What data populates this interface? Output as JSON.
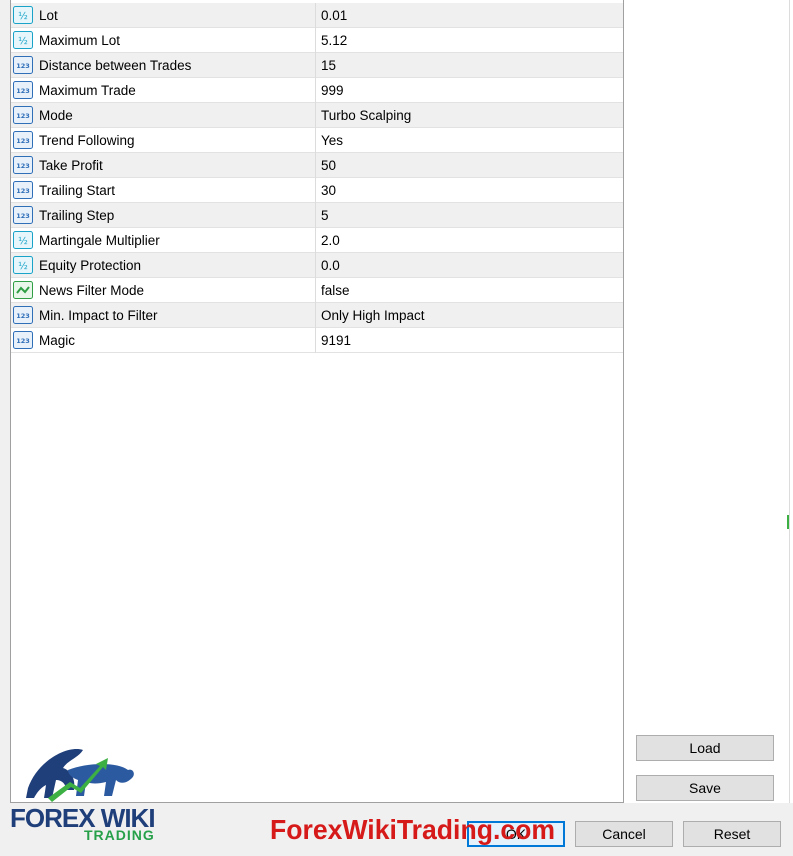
{
  "parameters": [
    {
      "name": "Lot",
      "value": "0.01",
      "icon": "fraction-icon"
    },
    {
      "name": "Maximum Lot",
      "value": "5.12",
      "icon": "fraction-icon"
    },
    {
      "name": "Distance between Trades",
      "value": "15",
      "icon": "integer-icon"
    },
    {
      "name": "Maximum Trade",
      "value": "999",
      "icon": "integer-icon"
    },
    {
      "name": "Mode",
      "value": "Turbo Scalping",
      "icon": "integer-icon"
    },
    {
      "name": "Trend Following",
      "value": "Yes",
      "icon": "integer-icon"
    },
    {
      "name": "Take Profit",
      "value": "50",
      "icon": "integer-icon"
    },
    {
      "name": "Trailing Start",
      "value": "30",
      "icon": "integer-icon"
    },
    {
      "name": "Trailing Step",
      "value": "5",
      "icon": "integer-icon"
    },
    {
      "name": "Martingale Multiplier",
      "value": "2.0",
      "icon": "fraction-icon"
    },
    {
      "name": "Equity Protection",
      "value": "0.0",
      "icon": "fraction-icon"
    },
    {
      "name": "News Filter Mode",
      "value": "false",
      "icon": "boolean-icon"
    },
    {
      "name": "Min. Impact to Filter",
      "value": "Only High Impact",
      "icon": "integer-icon"
    },
    {
      "name": "Magic",
      "value": "9191",
      "icon": "integer-icon"
    }
  ],
  "buttons": {
    "load": "Load",
    "save": "Save",
    "ok": "OK",
    "cancel": "Cancel",
    "reset": "Reset"
  },
  "icon_glyphs": {
    "fraction": "½",
    "integer": "123"
  },
  "watermark": {
    "text": "ForexWikiTrading.com"
  },
  "logo": {
    "line1": "FOREX WIKI",
    "line2": "TRADING"
  },
  "colors": {
    "fraction_icon": "#1aa3c8",
    "integer_icon": "#2f6fb8",
    "boolean_icon": "#2f9e44",
    "watermark": "#d61a1a",
    "ok_border": "#0078d7"
  }
}
